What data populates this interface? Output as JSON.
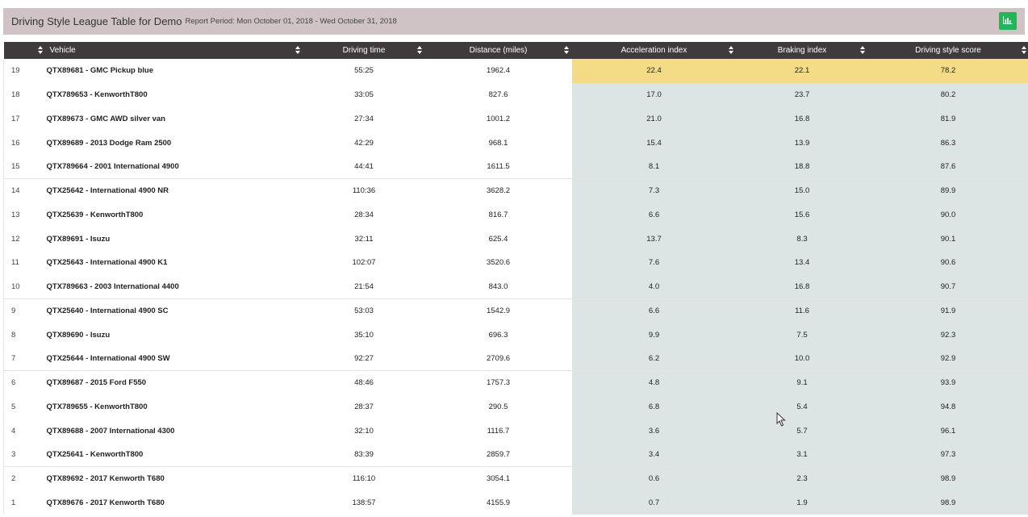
{
  "header": {
    "title": "Driving Style League Table for Demo",
    "period": "Report Period: Mon October 01, 2018 - Wed October 31, 2018",
    "chart_button_icon": "bar-chart-icon"
  },
  "columns": {
    "vehicle": "Vehicle",
    "driving_time": "Driving time",
    "distance": "Distance (miles)",
    "acceleration": "Acceleration index",
    "braking": "Braking index",
    "score": "Driving style score"
  },
  "colors": {
    "header_bar": "#cfc3c5",
    "table_header": "#3f3b3d",
    "highlight_top": "#f4dc86",
    "highlight": "#dde4e4",
    "chart_button": "#27b35a"
  },
  "rows": [
    {
      "rank": "19",
      "vehicle": "QTX89681 - GMC Pickup blue",
      "time": "55:25",
      "distance": "1962.4",
      "accel": "22.4",
      "braking": "22.1",
      "score": "78.2"
    },
    {
      "rank": "18",
      "vehicle": "QTX789653 - KenworthT800",
      "time": "33:05",
      "distance": "827.6",
      "accel": "17.0",
      "braking": "23.7",
      "score": "80.2"
    },
    {
      "rank": "17",
      "vehicle": "QTX89673 - GMC AWD silver van",
      "time": "27:34",
      "distance": "1001.2",
      "accel": "21.0",
      "braking": "16.8",
      "score": "81.9"
    },
    {
      "rank": "16",
      "vehicle": "QTX89689 - 2013 Dodge Ram 2500",
      "time": "42:29",
      "distance": "968.1",
      "accel": "15.4",
      "braking": "13.9",
      "score": "86.3"
    },
    {
      "rank": "15",
      "vehicle": "QTX789664 - 2001 International 4900",
      "time": "44:41",
      "distance": "1611.5",
      "accel": "8.1",
      "braking": "18.8",
      "score": "87.6"
    },
    {
      "rank": "14",
      "vehicle": "QTX25642 - International 4900 NR",
      "time": "110:36",
      "distance": "3628.2",
      "accel": "7.3",
      "braking": "15.0",
      "score": "89.9"
    },
    {
      "rank": "13",
      "vehicle": "QTX25639 - KenworthT800",
      "time": "28:34",
      "distance": "816.7",
      "accel": "6.6",
      "braking": "15.6",
      "score": "90.0"
    },
    {
      "rank": "12",
      "vehicle": "QTX89691 - Isuzu",
      "time": "32:11",
      "distance": "625.4",
      "accel": "13.7",
      "braking": "8.3",
      "score": "90.1"
    },
    {
      "rank": "11",
      "vehicle": "QTX25643 - International 4900 K1",
      "time": "102:07",
      "distance": "3520.6",
      "accel": "7.6",
      "braking": "13.4",
      "score": "90.6"
    },
    {
      "rank": "10",
      "vehicle": "QTX789663 - 2003 International 4400",
      "time": "21:54",
      "distance": "843.0",
      "accel": "4.0",
      "braking": "16.8",
      "score": "90.7"
    },
    {
      "rank": "9",
      "vehicle": "QTX25640 - International 4900 SC",
      "time": "53:03",
      "distance": "1542.9",
      "accel": "6.6",
      "braking": "11.6",
      "score": "91.9"
    },
    {
      "rank": "8",
      "vehicle": "QTX89690 - Isuzu",
      "time": "35:10",
      "distance": "696.3",
      "accel": "9.9",
      "braking": "7.5",
      "score": "92.3"
    },
    {
      "rank": "7",
      "vehicle": "QTX25644 - International 4900 SW",
      "time": "92:27",
      "distance": "2709.6",
      "accel": "6.2",
      "braking": "10.0",
      "score": "92.9"
    },
    {
      "rank": "6",
      "vehicle": "QTX89687 - 2015 Ford F550",
      "time": "48:46",
      "distance": "1757.3",
      "accel": "4.8",
      "braking": "9.1",
      "score": "93.9"
    },
    {
      "rank": "5",
      "vehicle": "QTX789655 - KenworthT800",
      "time": "28:37",
      "distance": "290.5",
      "accel": "6.8",
      "braking": "5.4",
      "score": "94.8"
    },
    {
      "rank": "4",
      "vehicle": "QTX89688 - 2007 International 4300",
      "time": "32:10",
      "distance": "1116.7",
      "accel": "3.6",
      "braking": "5.7",
      "score": "96.1"
    },
    {
      "rank": "3",
      "vehicle": "QTX25641 - KenworthT800",
      "time": "83:39",
      "distance": "2859.7",
      "accel": "3.4",
      "braking": "3.1",
      "score": "97.3"
    },
    {
      "rank": "2",
      "vehicle": "QTX89692 - 2017 Kenworth T680",
      "time": "116:10",
      "distance": "3054.1",
      "accel": "0.6",
      "braking": "2.3",
      "score": "98.9"
    },
    {
      "rank": "1",
      "vehicle": "QTX89676 - 2017 Kenworth T680",
      "time": "138:57",
      "distance": "4155.9",
      "accel": "0.7",
      "braking": "1.9",
      "score": "98.9"
    }
  ]
}
